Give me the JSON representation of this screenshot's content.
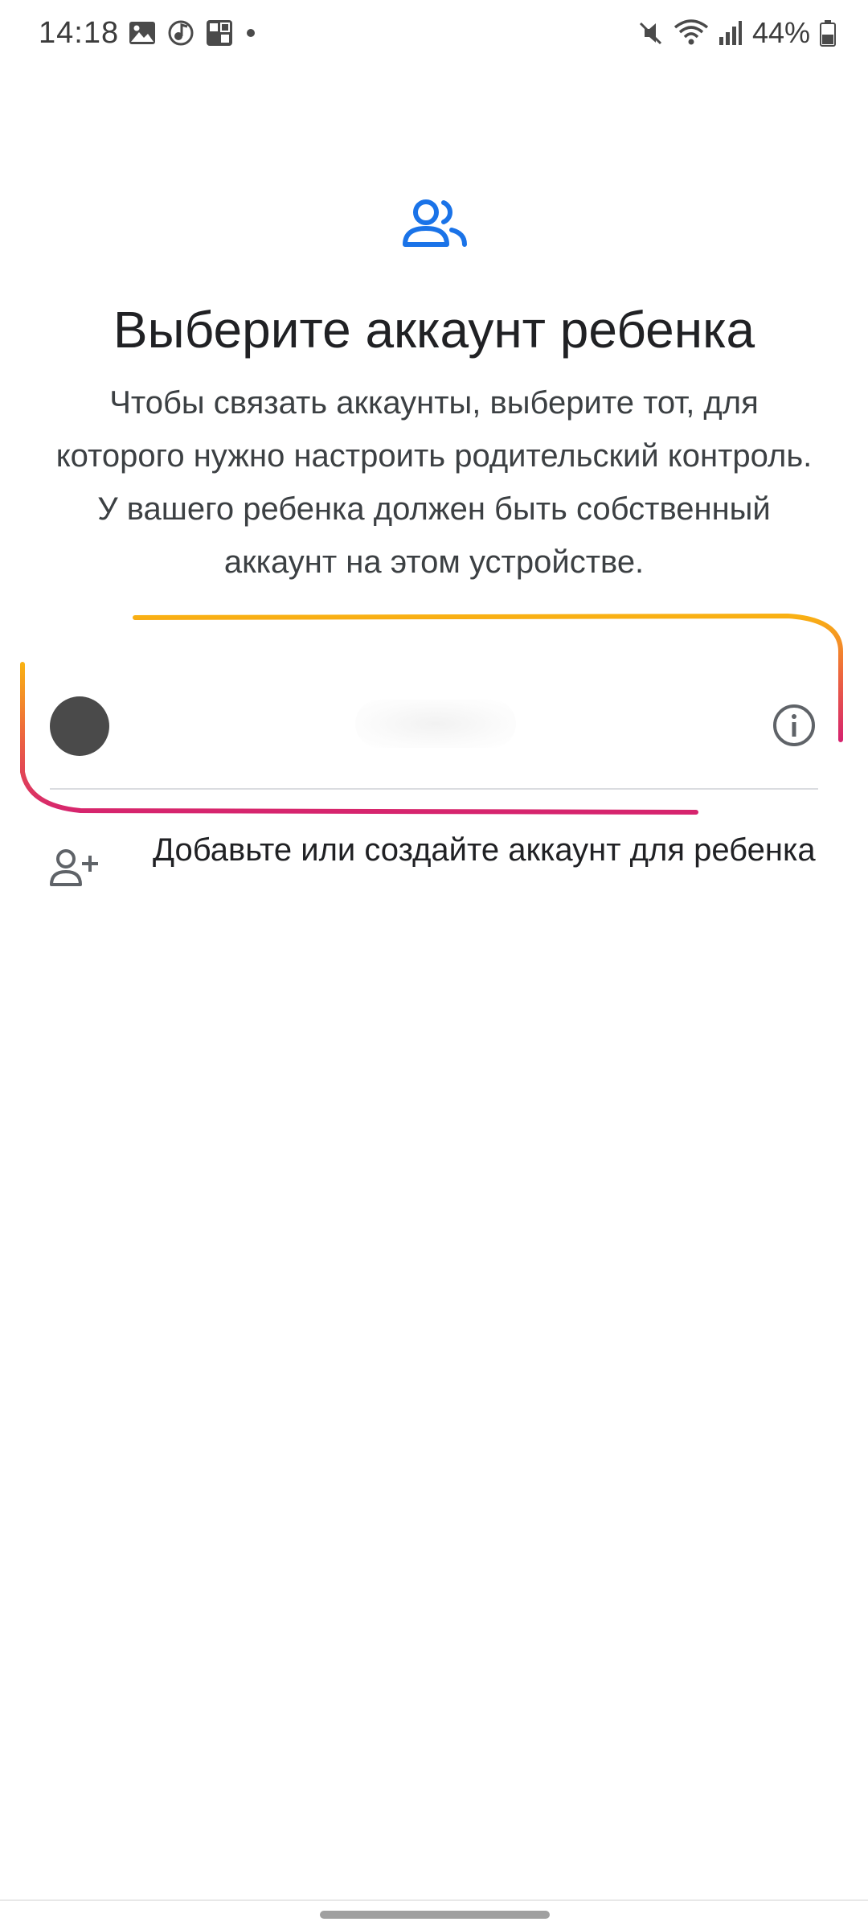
{
  "status_bar": {
    "time": "14:18",
    "battery": "44%",
    "icons_left": [
      "gallery-icon",
      "music-note-icon",
      "crossword-icon",
      "notification-dot-icon"
    ],
    "icons_right": [
      "mute-icon",
      "wifi-icon",
      "signal-icon",
      "battery-icon"
    ]
  },
  "header": {
    "icon": "family-link-group-icon",
    "title": "Выберите аккаунт ребенка",
    "description": "Чтобы связать аккаунты, выберите тот, для которого нужно настроить родительский контроль. У вашего ребенка должен быть собственный аккаунт на этом устройстве."
  },
  "account": {
    "name": "",
    "avatar_color": "#4a4a4a",
    "info_icon": "info-icon"
  },
  "add_account": {
    "icon": "person-add-icon",
    "label": "Добавьте или создайте аккаунт для ребенка"
  },
  "colors": {
    "accent": "#1a73e8",
    "marker_top": "#f9b113",
    "marker_bottom": "#d6246e"
  }
}
